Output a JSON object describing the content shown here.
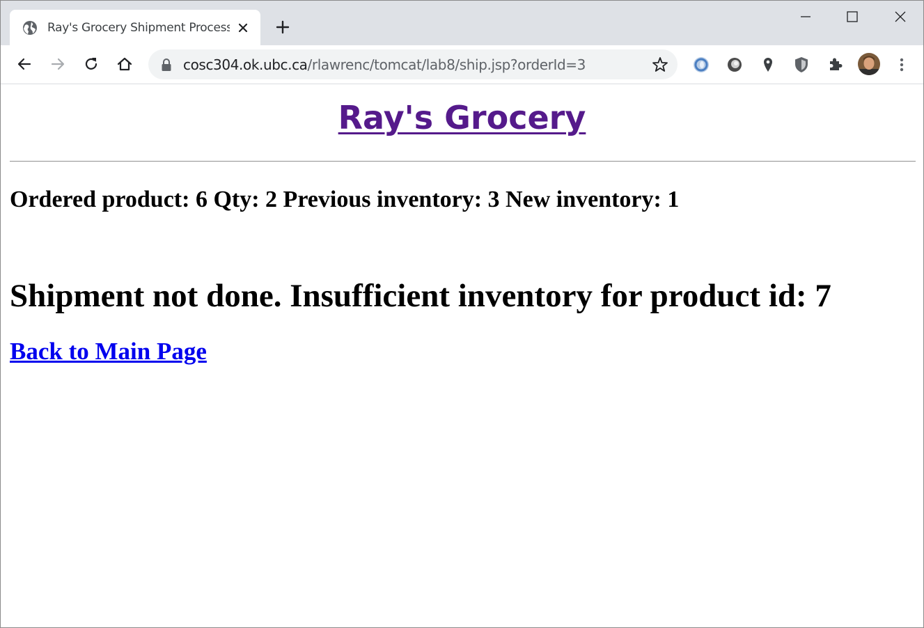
{
  "browser": {
    "tab_title": "Ray's Grocery Shipment Processing",
    "url_host": "cosc304.ok.ubc.ca",
    "url_path": "/rlawrenc/tomcat/lab8/ship.jsp?orderId=3",
    "icons": [
      "globe-icon",
      "close-icon",
      "plus-icon",
      "minimize-icon",
      "maximize-icon",
      "back-icon",
      "forward-icon",
      "reload-icon",
      "home-icon",
      "lock-icon",
      "star-icon",
      "extension-blue-ring-icon",
      "extension-gray-orb-icon",
      "location-pin-icon",
      "shield-icon",
      "puzzle-icon",
      "profile-avatar",
      "kebab-menu-icon"
    ]
  },
  "page": {
    "site_title": "Ray's Grocery",
    "order_line": "Ordered product: 6 Qty: 2 Previous inventory: 3 New inventory: 1",
    "status_message": "Shipment not done. Insufficient inventory for product id: 7",
    "back_link": "Back to Main Page"
  },
  "colors": {
    "visited_link": "#551a8b",
    "link": "#0000ee",
    "tabstrip": "#dee1e6",
    "omnibox": "#f1f3f4"
  }
}
